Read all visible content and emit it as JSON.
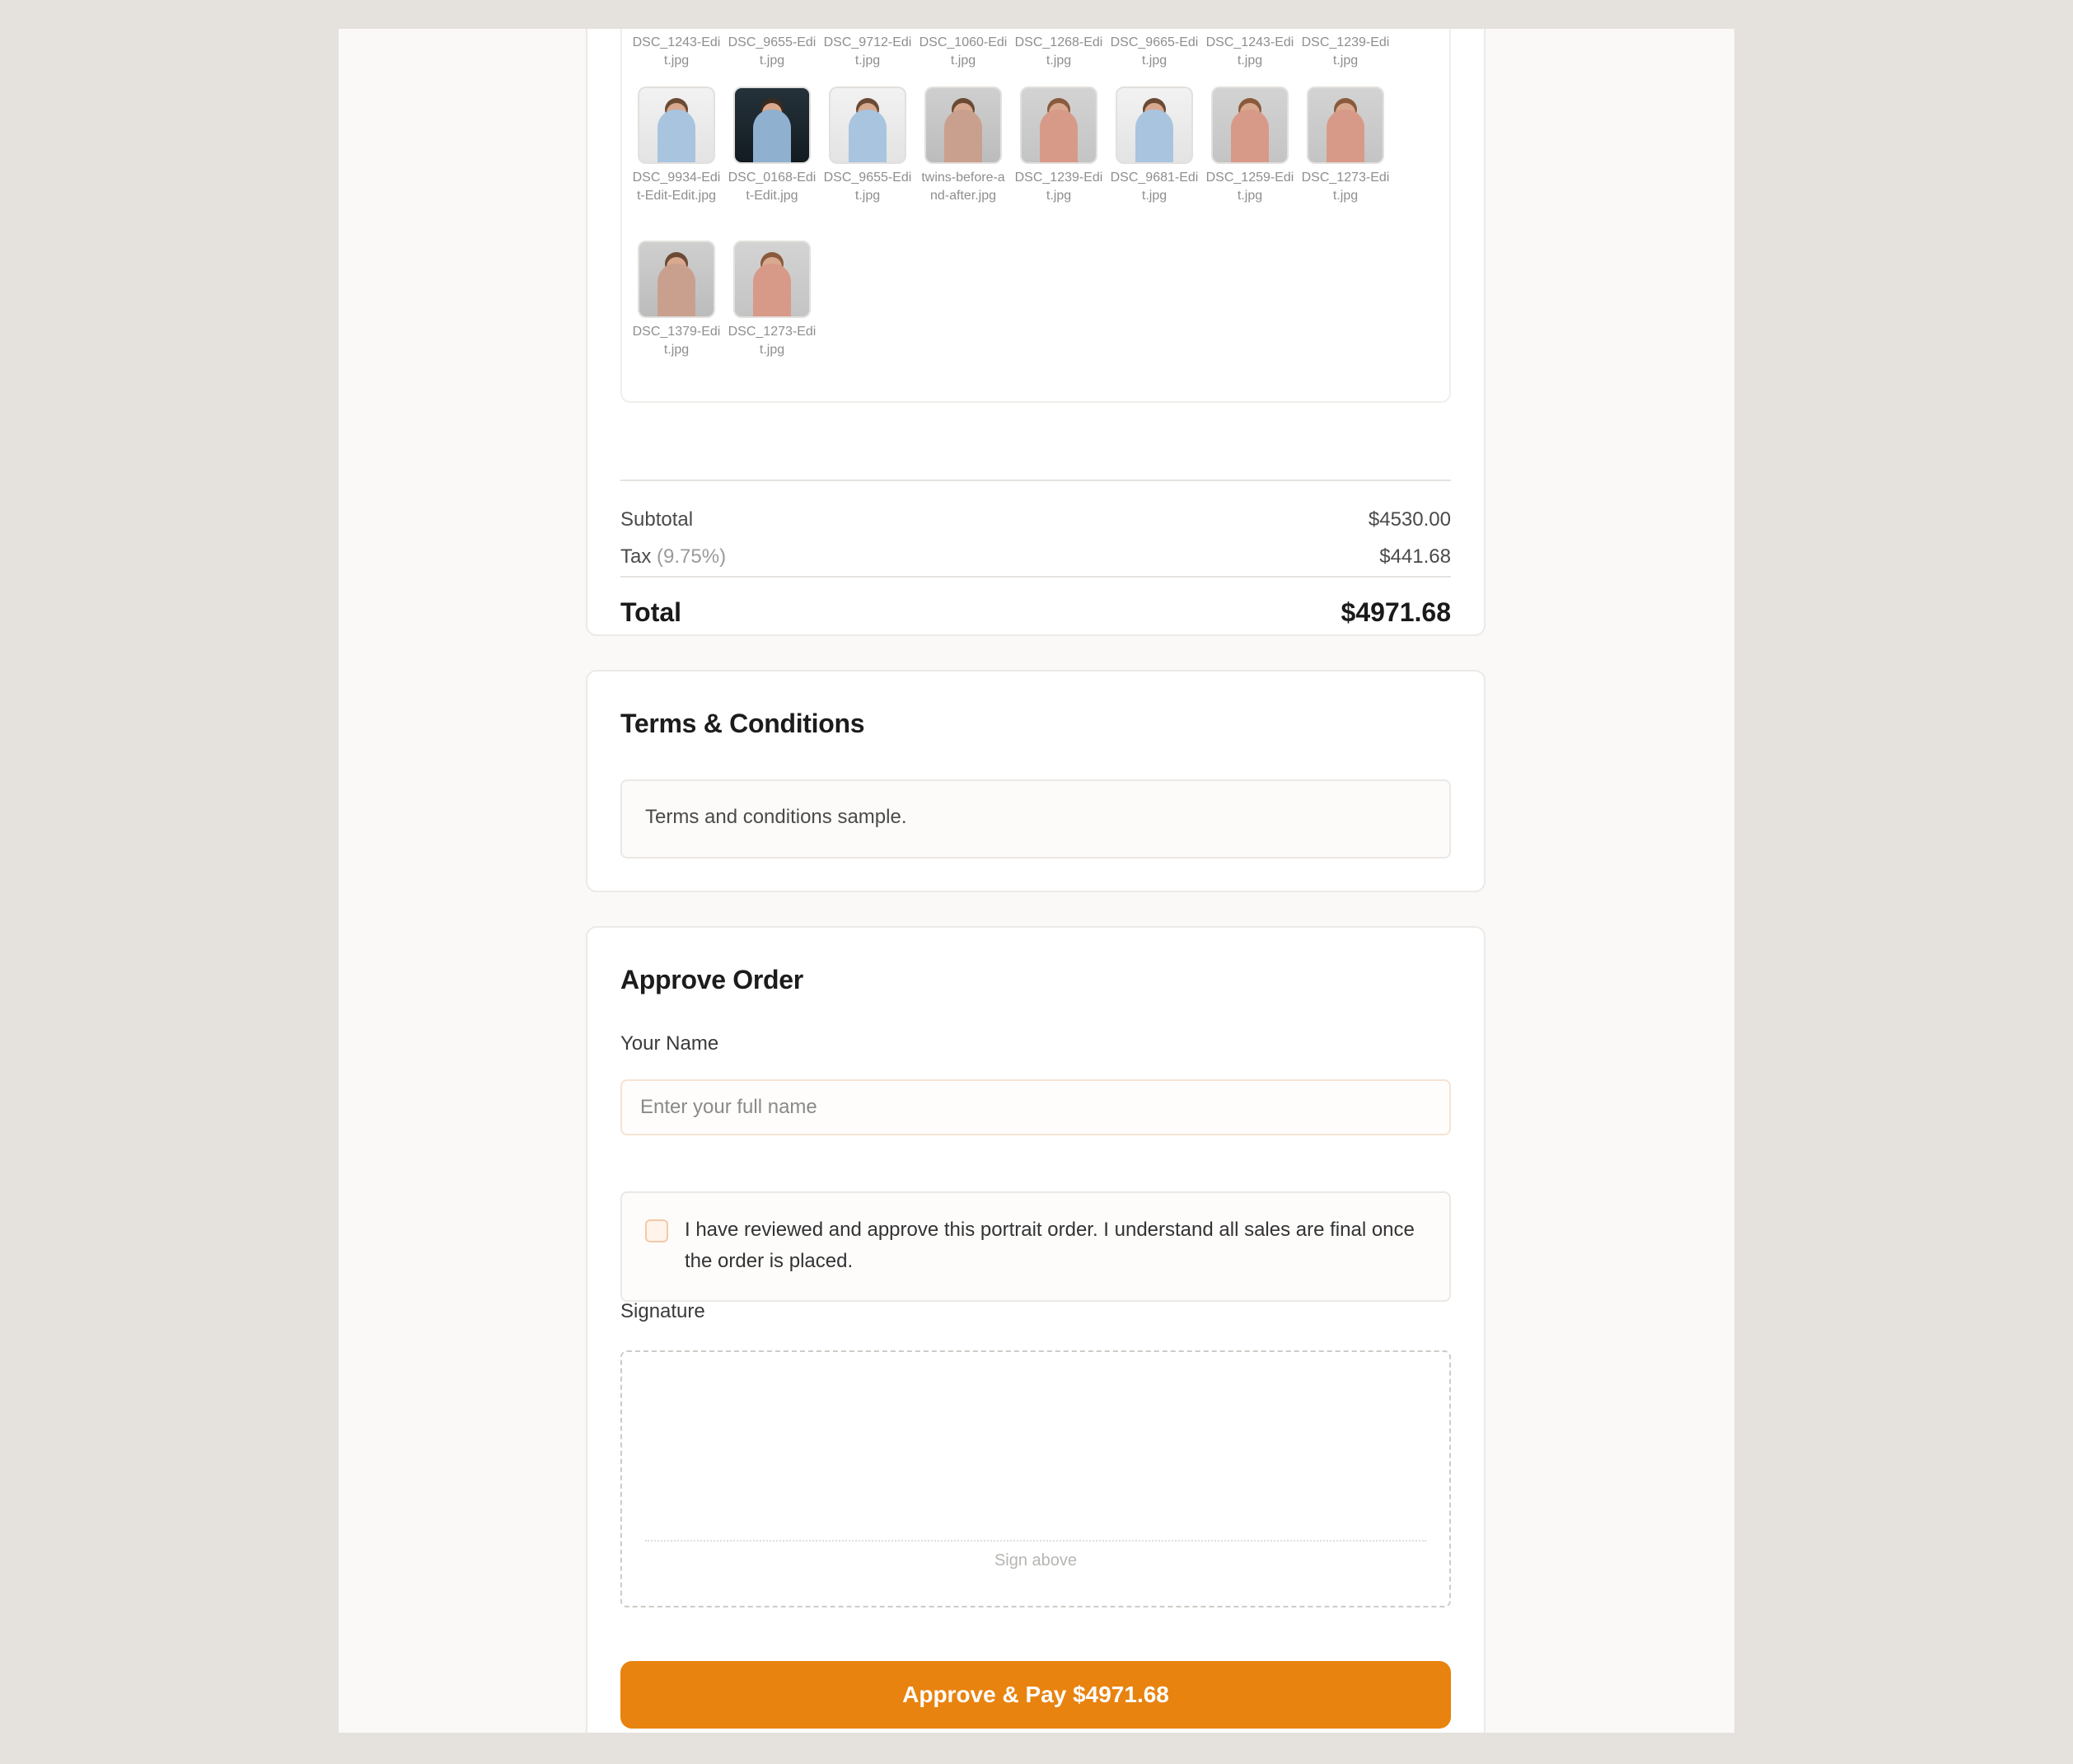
{
  "gallery": {
    "rows": [
      [
        {
          "filename": "DSC_1243-Edit.jpg",
          "tone": "pink"
        },
        {
          "filename": "DSC_9655-Edit.jpg",
          "tone": "light"
        },
        {
          "filename": "DSC_9712-Edit.jpg",
          "tone": "light"
        },
        {
          "filename": "DSC_1060-Edit.jpg",
          "tone": "light"
        },
        {
          "filename": "DSC_1268-Edit.jpg",
          "tone": "pink"
        },
        {
          "filename": "DSC_9665-Edit.jpg",
          "tone": "light"
        },
        {
          "filename": "DSC_1243-Edit.jpg",
          "tone": "pink"
        },
        {
          "filename": "DSC_1239-Edit.jpg",
          "tone": "pink"
        }
      ],
      [
        {
          "filename": "DSC_9934-Edit-Edit-Edit.jpg",
          "tone": "light"
        },
        {
          "filename": "DSC_0168-Edit-Edit.jpg",
          "tone": "dark"
        },
        {
          "filename": "DSC_9655-Edit.jpg",
          "tone": "light"
        },
        {
          "filename": "twins-before-and-after.jpg",
          "tone": "gray"
        },
        {
          "filename": "DSC_1239-Edit.jpg",
          "tone": "pink"
        },
        {
          "filename": "DSC_9681-Edit.jpg",
          "tone": "light"
        },
        {
          "filename": "DSC_1259-Edit.jpg",
          "tone": "pink"
        },
        {
          "filename": "DSC_1273-Edit.jpg",
          "tone": "pink"
        }
      ],
      [
        {
          "filename": "DSC_1379-Edit.jpg",
          "tone": "gray"
        },
        {
          "filename": "DSC_1273-Edit.jpg",
          "tone": "pink"
        }
      ]
    ]
  },
  "summary": {
    "subtotal_label": "Subtotal",
    "subtotal_value": "$4530.00",
    "tax_label": "Tax",
    "tax_rate": "(9.75%)",
    "tax_value": "$441.68",
    "total_label": "Total",
    "total_value": "$4971.68"
  },
  "terms": {
    "title": "Terms & Conditions",
    "body": "Terms and conditions sample."
  },
  "approve": {
    "title": "Approve Order",
    "name_label": "Your Name",
    "name_placeholder": "Enter your full name",
    "name_value": "",
    "agree_text": "I have reviewed and approve this portrait order. I understand all sales are final once the order is placed.",
    "agree_checked": false,
    "signature_label": "Signature",
    "signature_hint": "Sign above",
    "pay_button": "Approve & Pay $4971.68"
  },
  "colors": {
    "accent": "#e8830f",
    "page_bg": "#e5e1dd",
    "card_bg": "#ffffff"
  }
}
